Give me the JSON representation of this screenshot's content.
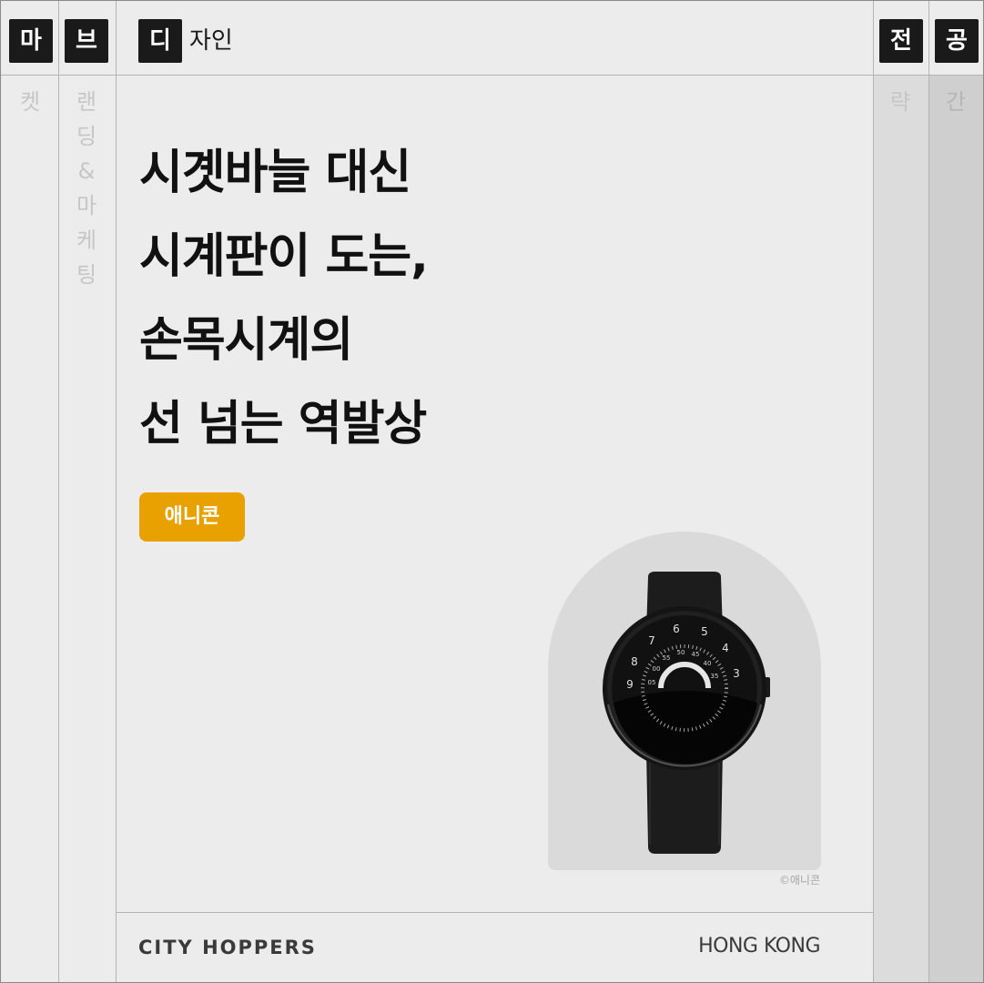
{
  "header": {
    "tags_left": [
      "마",
      "브",
      "디"
    ],
    "category_text": "자인",
    "tags_right": [
      "전",
      "공"
    ]
  },
  "vertical_columns": {
    "col1": [
      "켓"
    ],
    "col2": [
      "랜",
      "딩",
      "&",
      "마",
      "케",
      "팅"
    ],
    "col3": [
      "략"
    ],
    "col4": [
      "간"
    ]
  },
  "article": {
    "title_lines": [
      "시곗바늘 대신",
      "시계판이 도는,",
      "손목시계의",
      "선 넘는 역발상"
    ],
    "brand_badge": "애니콘",
    "image_credit": "©애니콘"
  },
  "watch": {
    "hour_numbers": [
      "9",
      "8",
      "7",
      "6",
      "5",
      "4",
      "3"
    ],
    "minute_numbers": [
      "05",
      "00",
      "55",
      "50",
      "45",
      "40",
      "35"
    ]
  },
  "footer": {
    "logo_text": "CITY HOPPERS",
    "location": "HONG KONG"
  },
  "colors": {
    "badge": "#e8a100",
    "tag_bg": "#1a1a1a",
    "background": "#ececec"
  }
}
